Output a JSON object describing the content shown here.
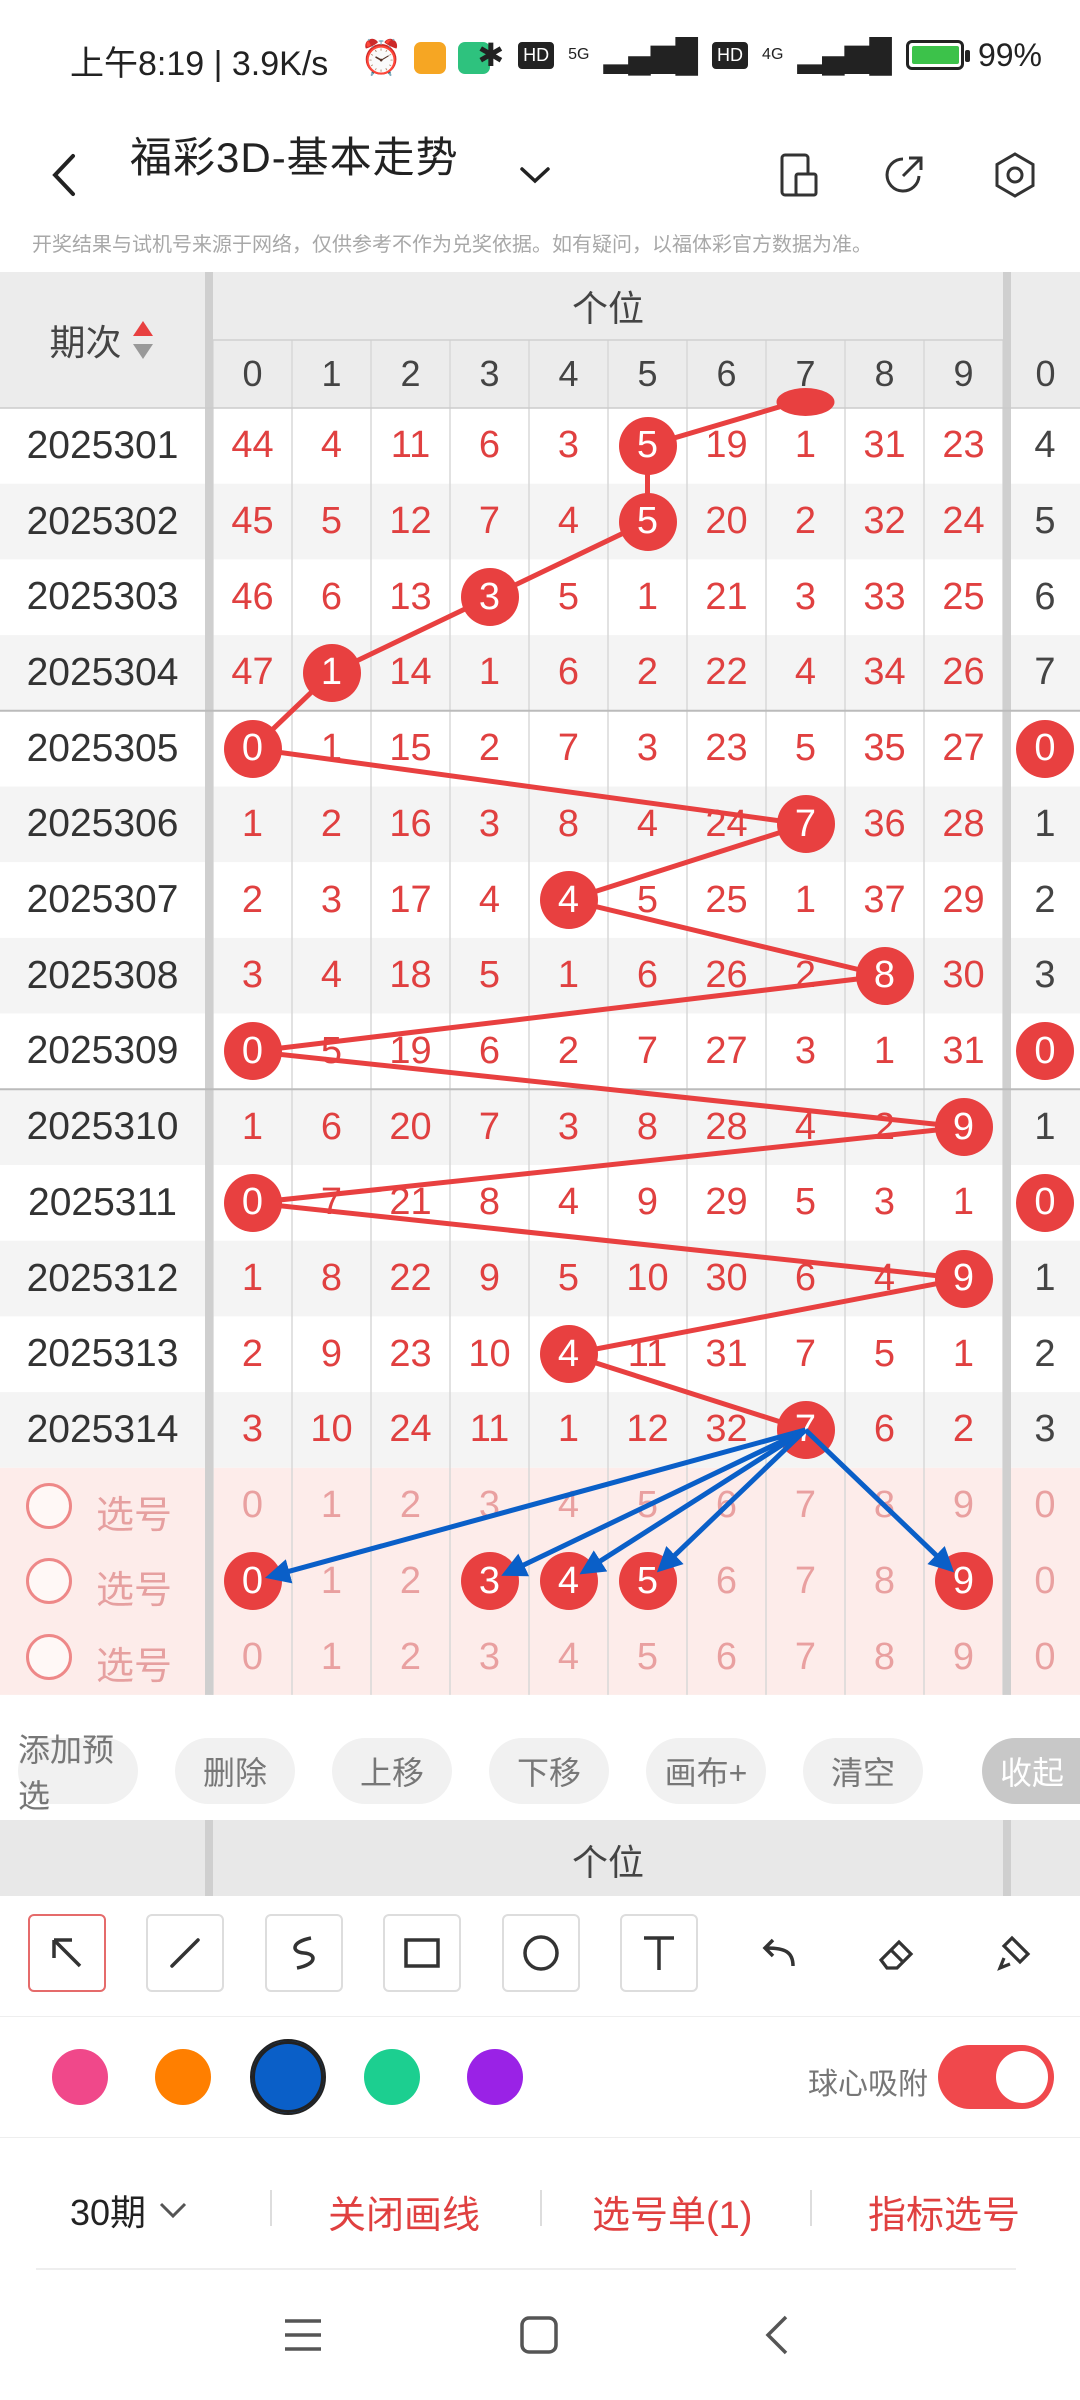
{
  "status_bar": {
    "time": "上午8:19 | 3.9K/s",
    "hd1": "HD",
    "net1": "5G",
    "hd2": "HD",
    "net2": "4G",
    "battery": "99%",
    "battery_level": 0.99
  },
  "title_bar": {
    "title": "福彩3D-基本走势",
    "icons": [
      "back-icon",
      "dropdown-chevron-icon",
      "phone-layout-icon",
      "share-icon",
      "settings-icon"
    ]
  },
  "notice": "开奖结果与试机号来源于网络，仅供参考不作为兑奖依据。如有疑问，以福体彩官方数据为准。",
  "chart": {
    "col_label": "期次",
    "section_title": "个位",
    "digits": [
      "0",
      "1",
      "2",
      "3",
      "4",
      "5",
      "6",
      "7",
      "8",
      "9"
    ],
    "extra_col": "0",
    "rows": [
      {
        "period": "2025301",
        "cells": [
          "44",
          "4",
          "11",
          "6",
          "3",
          "5",
          "19",
          "1",
          "31",
          "23"
        ],
        "extra": "4"
      },
      {
        "period": "2025302",
        "cells": [
          "45",
          "5",
          "12",
          "7",
          "4",
          "5",
          "20",
          "2",
          "32",
          "24"
        ],
        "extra": "5"
      },
      {
        "period": "2025303",
        "cells": [
          "46",
          "6",
          "13",
          "3",
          "5",
          "1",
          "21",
          "3",
          "33",
          "25"
        ],
        "extra": "6"
      },
      {
        "period": "2025304",
        "cells": [
          "47",
          "1",
          "14",
          "1",
          "6",
          "2",
          "22",
          "4",
          "34",
          "26"
        ],
        "extra": "7"
      },
      {
        "period": "2025305",
        "cells": [
          "0",
          "1",
          "15",
          "2",
          "7",
          "3",
          "23",
          "5",
          "35",
          "27"
        ],
        "extra": "0"
      },
      {
        "period": "2025306",
        "cells": [
          "1",
          "2",
          "16",
          "3",
          "8",
          "4",
          "24",
          "7",
          "36",
          "28"
        ],
        "extra": "1"
      },
      {
        "period": "2025307",
        "cells": [
          "2",
          "3",
          "17",
          "4",
          "4",
          "5",
          "25",
          "1",
          "37",
          "29"
        ],
        "extra": "2"
      },
      {
        "period": "2025308",
        "cells": [
          "3",
          "4",
          "18",
          "5",
          "1",
          "6",
          "26",
          "2",
          "8",
          "30"
        ],
        "extra": "3"
      },
      {
        "period": "2025309",
        "cells": [
          "0",
          "5",
          "19",
          "6",
          "2",
          "7",
          "27",
          "3",
          "1",
          "31"
        ],
        "extra": "0"
      },
      {
        "period": "2025310",
        "cells": [
          "1",
          "6",
          "20",
          "7",
          "3",
          "8",
          "28",
          "4",
          "2",
          "9"
        ],
        "extra": "1"
      },
      {
        "period": "2025311",
        "cells": [
          "0",
          "7",
          "21",
          "8",
          "4",
          "9",
          "29",
          "5",
          "3",
          "1"
        ],
        "extra": "0"
      },
      {
        "period": "2025312",
        "cells": [
          "1",
          "8",
          "22",
          "9",
          "5",
          "10",
          "30",
          "6",
          "4",
          "9"
        ],
        "extra": "1"
      },
      {
        "period": "2025313",
        "cells": [
          "2",
          "9",
          "23",
          "10",
          "4",
          "11",
          "31",
          "7",
          "5",
          "1"
        ],
        "extra": "2"
      },
      {
        "period": "2025314",
        "cells": [
          "3",
          "10",
          "24",
          "11",
          "1",
          "12",
          "32",
          "7",
          "6",
          "2"
        ],
        "extra": "3"
      }
    ],
    "hit_digits": [
      5,
      5,
      3,
      1,
      0,
      7,
      4,
      8,
      0,
      9,
      0,
      9,
      4,
      7
    ],
    "extra_hits": [
      false,
      false,
      false,
      false,
      true,
      false,
      false,
      false,
      true,
      false,
      true,
      false,
      false,
      false
    ],
    "select_rows": [
      {
        "label": "选号",
        "cells": [
          "0",
          "1",
          "2",
          "3",
          "4",
          "5",
          "6",
          "7",
          "8",
          "9"
        ],
        "extra": "0",
        "selected": []
      },
      {
        "label": "选号",
        "cells": [
          "0",
          "1",
          "2",
          "3",
          "4",
          "5",
          "6",
          "7",
          "8",
          "9"
        ],
        "extra": "0",
        "selected": [
          0,
          3,
          4,
          5,
          9
        ]
      },
      {
        "label": "选号",
        "cells": [
          "0",
          "1",
          "2",
          "3",
          "4",
          "5",
          "6",
          "7",
          "8",
          "9"
        ],
        "extra": "0",
        "selected": []
      }
    ],
    "arrow_from_digit": 7,
    "arrow_targets": [
      0,
      3,
      4,
      5,
      9
    ]
  },
  "actions": [
    "添加预选",
    "删除",
    "上移",
    "下移",
    "画布+",
    "清空",
    "收起"
  ],
  "second_section_title": "个位",
  "tools": [
    "arrow-tool-icon",
    "line-tool-icon",
    "curve-tool-icon",
    "rectangle-tool-icon",
    "circle-tool-icon",
    "text-tool-icon",
    "undo-icon",
    "eraser-icon",
    "clear-brush-icon"
  ],
  "colors": {
    "pink": "#f0488a",
    "orange": "#ff7f00",
    "blue": "#0a5fc8",
    "green": "#1ccf90",
    "purple": "#9a22e6",
    "selected": "blue",
    "line_red": "#e84040"
  },
  "snap_label": "球心吸附",
  "snap_on": true,
  "footer": {
    "periods": "30期",
    "close_lines": "关闭画线",
    "selection_list": "选号单(1)",
    "indicator": "指标选号"
  }
}
